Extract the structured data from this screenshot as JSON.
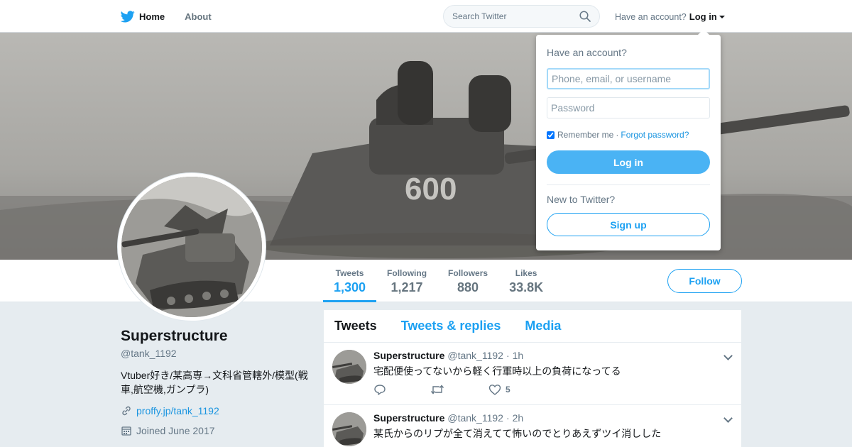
{
  "nav": {
    "home_label": "Home",
    "about_label": "About",
    "search_placeholder": "Search Twitter",
    "account_prompt": "Have an account?",
    "login_label": "Log in"
  },
  "profile": {
    "name": "Superstructure",
    "handle": "@tank_1192",
    "bio": "Vtuber好き/某高専→文科省管轄外/模型(戦車,航空機,ガンプラ)",
    "link": "proffy.jp/tank_1192",
    "joined": "Joined June 2017",
    "follow_label": "Follow"
  },
  "stats": [
    {
      "label": "Tweets",
      "value": "1,300",
      "active": true
    },
    {
      "label": "Following",
      "value": "1,217",
      "active": false
    },
    {
      "label": "Followers",
      "value": "880",
      "active": false
    },
    {
      "label": "Likes",
      "value": "33.8K",
      "active": false
    }
  ],
  "timeline": {
    "tabs": [
      "Tweets",
      "Tweets & replies",
      "Media"
    ],
    "tweets": [
      {
        "name": "Superstructure",
        "handle": "@tank_1192",
        "time": "1h",
        "text": "宅配便使ってないから軽く行軍時以上の負荷になってる",
        "likes": "5"
      },
      {
        "name": "Superstructure",
        "handle": "@tank_1192",
        "time": "2h",
        "text": "某氏からのリプが全て消えてて怖いのでとりあえずツイ消しした",
        "likes": ""
      }
    ]
  },
  "login_dropdown": {
    "title": "Have an account?",
    "username_placeholder": "Phone, email, or username",
    "password_placeholder": "Password",
    "remember_label": "Remember me",
    "separator": "·",
    "forgot_label": "Forgot password?",
    "login_button": "Log in",
    "new_prompt": "New to Twitter?",
    "signup_button": "Sign up"
  },
  "colors": {
    "accent": "#1da1f2",
    "login_button": "#4ab3f4",
    "background": "#e6ecf0"
  },
  "icons": [
    "twitter-bird-icon",
    "search-icon",
    "link-icon",
    "calendar-icon",
    "reply-icon",
    "retweet-icon",
    "like-icon",
    "chevron-down-icon"
  ]
}
